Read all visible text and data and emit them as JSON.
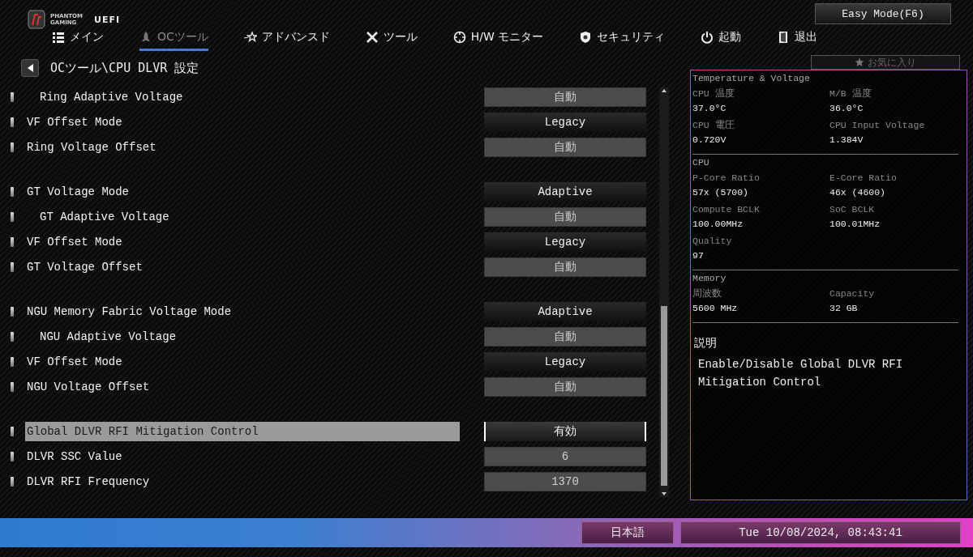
{
  "logo": {
    "brand_top": "PHANTOM",
    "brand_bottom": "GAMING",
    "product": "UEFI"
  },
  "easy_mode_button": "Easy Mode(F6)",
  "tabs": [
    {
      "label": "メイン",
      "selected": false
    },
    {
      "label": "OCツール",
      "selected": true
    },
    {
      "label": "アドバンスド",
      "selected": false
    },
    {
      "label": "ツール",
      "selected": false
    },
    {
      "label": "H/W モニター",
      "selected": false
    },
    {
      "label": "セキュリティ",
      "selected": false
    },
    {
      "label": "起動",
      "selected": false
    },
    {
      "label": "退出",
      "selected": false
    }
  ],
  "breadcrumb": "OCツール\\CPU DLVR 設定",
  "favorites_button": "お気に入り",
  "settings_groups": [
    {
      "rows": [
        {
          "label": "Ring Adaptive Voltage",
          "value": "自動",
          "kind": "field",
          "indented": true,
          "selected": false
        },
        {
          "label": "VF Offset Mode",
          "value": "Legacy",
          "kind": "select",
          "indented": false,
          "selected": false
        },
        {
          "label": "Ring Voltage Offset",
          "value": "自動",
          "kind": "field",
          "indented": false,
          "selected": false
        }
      ]
    },
    {
      "rows": [
        {
          "label": "GT Voltage Mode",
          "value": "Adaptive",
          "kind": "select",
          "indented": false,
          "selected": false
        },
        {
          "label": "GT Adaptive Voltage",
          "value": "自動",
          "kind": "field",
          "indented": true,
          "selected": false
        },
        {
          "label": "VF Offset Mode",
          "value": "Legacy",
          "kind": "select",
          "indented": false,
          "selected": false
        },
        {
          "label": "GT Voltage Offset",
          "value": "自動",
          "kind": "field",
          "indented": false,
          "selected": false
        }
      ]
    },
    {
      "rows": [
        {
          "label": "NGU Memory Fabric Voltage Mode",
          "value": "Adaptive",
          "kind": "select",
          "indented": false,
          "selected": false
        },
        {
          "label": "NGU Adaptive Voltage",
          "value": "自動",
          "kind": "field",
          "indented": true,
          "selected": false
        },
        {
          "label": "VF Offset Mode",
          "value": "Legacy",
          "kind": "select",
          "indented": false,
          "selected": false
        },
        {
          "label": "NGU Voltage Offset",
          "value": "自動",
          "kind": "field",
          "indented": false,
          "selected": false
        }
      ]
    },
    {
      "rows": [
        {
          "label": "Global DLVR RFI Mitigation Control",
          "value": "有効",
          "kind": "select",
          "indented": false,
          "selected": true
        },
        {
          "label": "DLVR SSC Value",
          "value": "6",
          "kind": "field",
          "indented": false,
          "selected": false
        },
        {
          "label": "DLVR RFI Frequency",
          "value": "1370",
          "kind": "field",
          "indented": false,
          "selected": false
        }
      ]
    }
  ],
  "monitor": {
    "sections": [
      {
        "title": "Temperature & Voltage",
        "items": [
          {
            "label": "CPU 温度",
            "value": "37.0°C"
          },
          {
            "label": "M/B 温度",
            "value": "36.0°C"
          },
          {
            "label": "CPU 電圧",
            "value": "0.720V"
          },
          {
            "label": "CPU Input Voltage",
            "value": "1.384V"
          }
        ]
      },
      {
        "title": "CPU",
        "items": [
          {
            "label": "P-Core Ratio",
            "value": "57x (5700)"
          },
          {
            "label": "E-Core Ratio",
            "value": "46x (4600)"
          },
          {
            "label": "Compute BCLK",
            "value": "100.00MHz"
          },
          {
            "label": "SoC BCLK",
            "value": "100.01MHz"
          },
          {
            "label": "Quality",
            "value": "97"
          }
        ]
      },
      {
        "title": "Memory",
        "items": [
          {
            "label": "周波数",
            "value": "5600 MHz"
          },
          {
            "label": "Capacity",
            "value": "32 GB"
          }
        ]
      }
    ],
    "description_title": "説明",
    "description": "Enable/Disable Global DLVR RFI Mitigation Control"
  },
  "status_bar": {
    "language": "日本語",
    "datetime": "Tue 10/08/2024, 08:43:41"
  }
}
